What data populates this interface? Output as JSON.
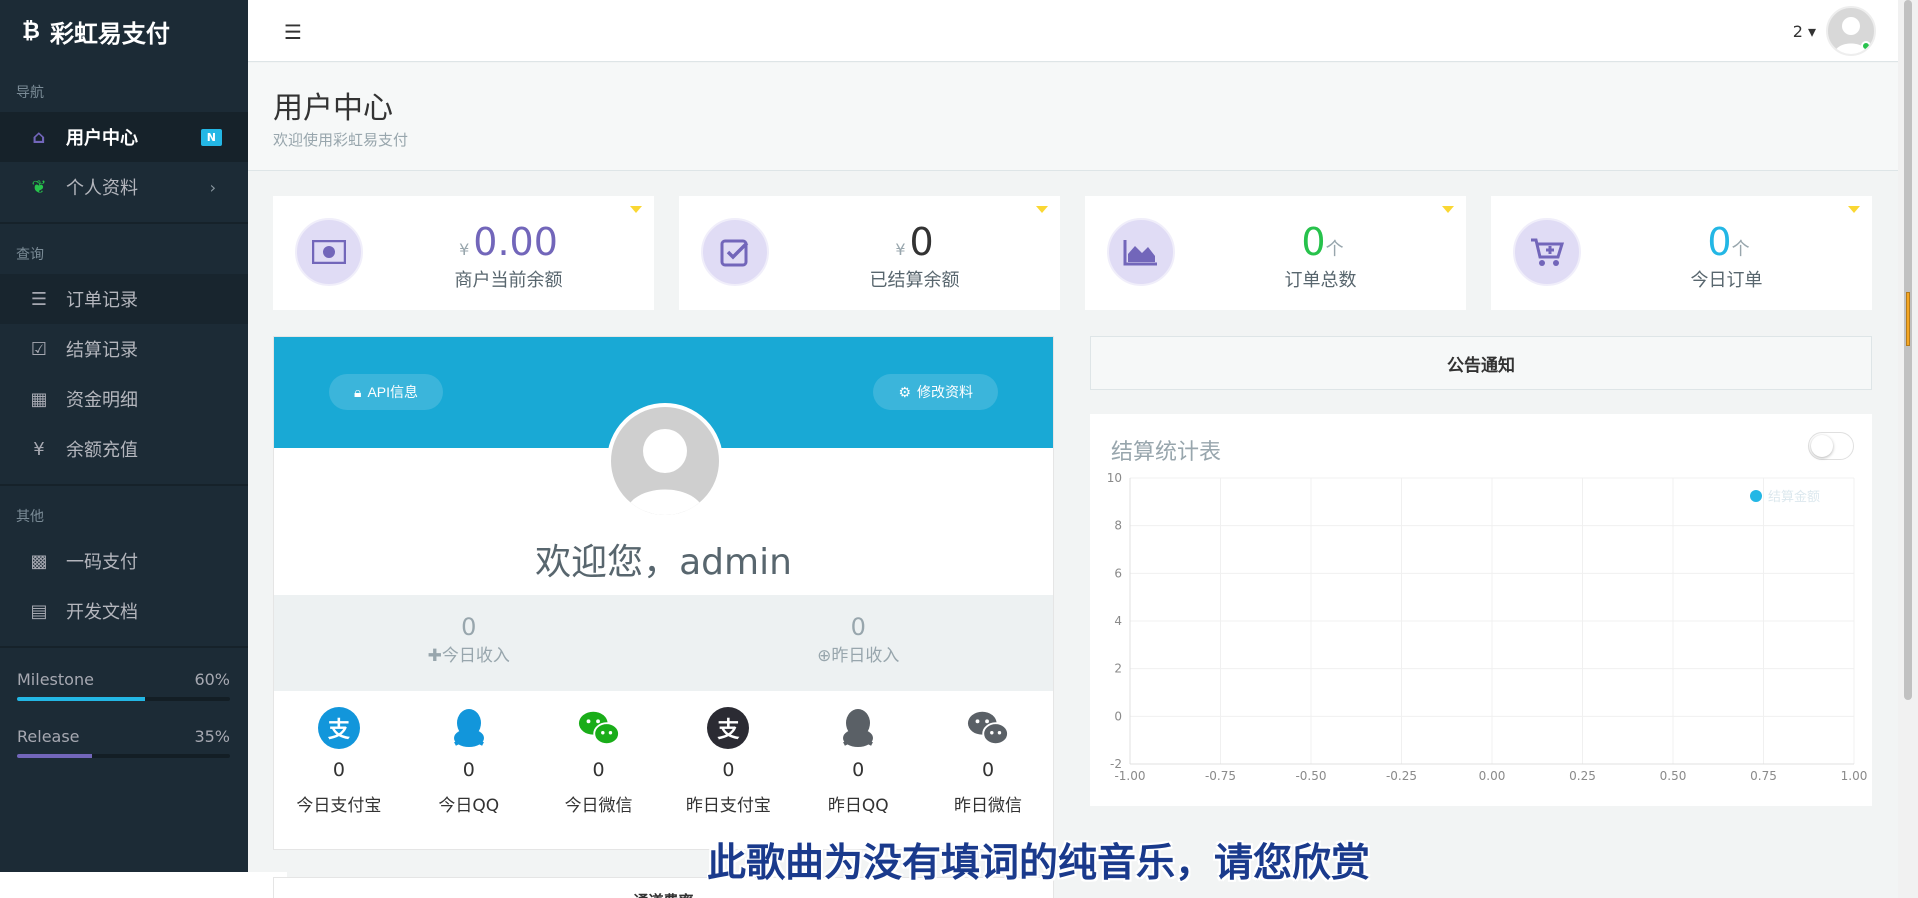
{
  "brand": {
    "name": "彩虹易支付",
    "logo": "bitcoin-icon"
  },
  "sidebar": {
    "sections": [
      {
        "header": "导航",
        "items": [
          {
            "label": "用户中心",
            "icon": "home-icon",
            "badge": "N",
            "active": true
          },
          {
            "label": "个人资料",
            "icon": "leaf-icon",
            "has_submenu": true
          }
        ]
      },
      {
        "header": "查询",
        "items": [
          {
            "label": "订单记录",
            "icon": "list-icon"
          },
          {
            "label": "结算记录",
            "icon": "check-square-icon"
          },
          {
            "label": "资金明细",
            "icon": "calendar-icon"
          },
          {
            "label": "余额充值",
            "icon": "yen-icon"
          }
        ]
      },
      {
        "header": "其他",
        "items": [
          {
            "label": "一码支付",
            "icon": "qrcode-icon"
          },
          {
            "label": "开发文档",
            "icon": "book-icon"
          }
        ]
      }
    ],
    "progress": [
      {
        "label": "Milestone",
        "value_text": "60%",
        "value": 0.6,
        "color": "#23b7e5"
      },
      {
        "label": "Release",
        "value_text": "35%",
        "value": 0.35,
        "color": "#7266ba"
      }
    ]
  },
  "header": {
    "user_number": "2"
  },
  "page": {
    "title": "用户中心",
    "subtitle": "欢迎使用彩虹易支付"
  },
  "stats": [
    {
      "currency": "¥",
      "value": "0.00",
      "unit": "",
      "label": "商户当前余额",
      "icon": "money-icon",
      "color": "#7266ba"
    },
    {
      "currency": "¥",
      "value": "0",
      "unit": "",
      "label": "已结算余额",
      "icon": "check-square-icon",
      "color": "#333333"
    },
    {
      "currency": "",
      "value": "0",
      "unit": "个",
      "label": "订单总数",
      "icon": "area-chart-icon",
      "color": "#27c24c"
    },
    {
      "currency": "",
      "value": "0",
      "unit": "个",
      "label": "今日订单",
      "icon": "cart-plus-icon",
      "color": "#23b7e5"
    }
  ],
  "profile": {
    "api_button": "API信息",
    "edit_button": "修改资料",
    "welcome": "欢迎您，admin",
    "income": [
      {
        "value": "0",
        "label": "今日收入",
        "icon": "plus-icon"
      },
      {
        "value": "0",
        "label": "昨日收入",
        "icon": "plus-circle-icon"
      }
    ],
    "channels": [
      {
        "label": "今日支付宝",
        "value": "0",
        "icon": "alipay-icon",
        "color": "#1296db",
        "glyph": "支"
      },
      {
        "label": "今日QQ",
        "value": "0",
        "icon": "qq-icon",
        "color": "#1296db",
        "glyph": ""
      },
      {
        "label": "今日微信",
        "value": "0",
        "icon": "wechat-icon",
        "color": "#1aad19",
        "glyph": ""
      },
      {
        "label": "昨日支付宝",
        "value": "0",
        "icon": "alipay-icon",
        "color": "#2b2b33",
        "glyph": "支"
      },
      {
        "label": "昨日QQ",
        "value": "0",
        "icon": "qq-icon",
        "color": "#5a6066",
        "glyph": ""
      },
      {
        "label": "昨日微信",
        "value": "0",
        "icon": "wechat-icon",
        "color": "#5a6066",
        "glyph": ""
      }
    ]
  },
  "notice": {
    "title": "公告通知"
  },
  "chart": {
    "title": "结算统计表"
  },
  "chart_data": {
    "type": "line",
    "title": "结算统计表",
    "series": [
      {
        "name": "结算金额",
        "values": []
      }
    ],
    "xlim": [
      -1.0,
      1.0
    ],
    "ylim": [
      -2,
      10
    ],
    "x_ticks": [
      "-1.00",
      "-0.75",
      "-0.50",
      "-0.25",
      "0.00",
      "0.25",
      "0.50",
      "0.75",
      "1.00"
    ],
    "y_ticks": [
      "10",
      "8",
      "6",
      "4",
      "2",
      "0",
      "-2"
    ],
    "grid": true,
    "legend": "top-right",
    "legend_color": "#23b7e5"
  },
  "lower_panel": {
    "title": "通道费率"
  },
  "overlay": {
    "subtitle": "此歌曲为没有填词的纯音乐，请您欣赏"
  }
}
